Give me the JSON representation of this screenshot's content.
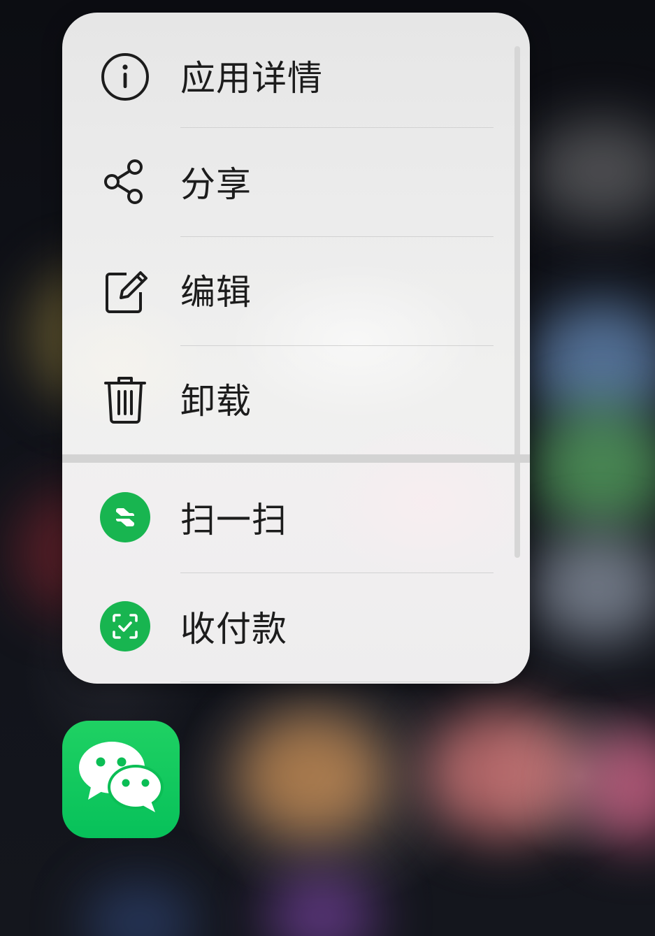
{
  "context_menu": {
    "items": [
      {
        "label": "应用详情",
        "icon": "info-circle-icon"
      },
      {
        "label": "分享",
        "icon": "share-icon"
      },
      {
        "label": "编辑",
        "icon": "edit-icon"
      },
      {
        "label": "卸载",
        "icon": "trash-icon"
      }
    ],
    "shortcuts": [
      {
        "label": "扫一扫",
        "icon": "scan-icon"
      },
      {
        "label": "收付款",
        "icon": "payment-scan-icon"
      }
    ]
  },
  "app": {
    "icon": "wechat-icon"
  },
  "colors": {
    "menu_background": "#ececec",
    "text": "#1c1c1c",
    "shortcut_green": "#18b550",
    "app_green": "#07c15a"
  }
}
